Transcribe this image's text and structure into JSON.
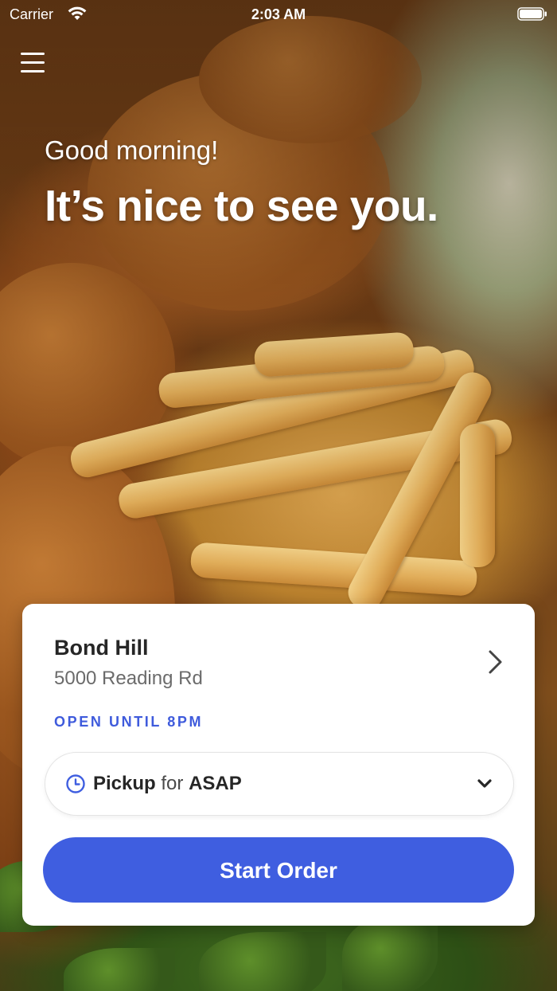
{
  "status_bar": {
    "carrier": "Carrier",
    "time": "2:03 AM"
  },
  "header": {
    "menu_icon": "hamburger-menu-icon",
    "greeting": "Good morning!",
    "headline": "It’s nice to see you."
  },
  "location": {
    "name": "Bond Hill",
    "address": "5000 Reading Rd",
    "status": "OPEN UNTIL 8PM"
  },
  "order_mode": {
    "mode": "Pickup",
    "connector": "for",
    "time": "ASAP"
  },
  "actions": {
    "start_order": "Start Order"
  },
  "colors": {
    "accent": "#3f5ee0",
    "status_text": "#3f5bdc",
    "card_bg": "#ffffff"
  }
}
